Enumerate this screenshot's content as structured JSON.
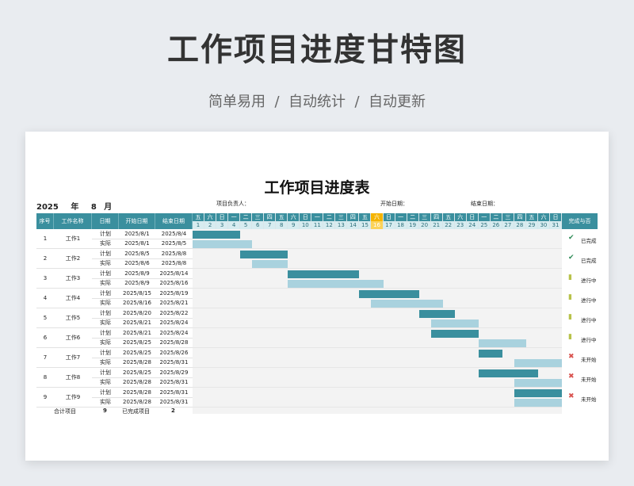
{
  "hero": {
    "title": "工作项目进度甘特图",
    "subtitle": "简单易用  /  自动统计  /  自动更新"
  },
  "sheet": {
    "title": "工作项目进度表",
    "year": "2025",
    "year_unit": "年",
    "month": "8",
    "month_unit": "月",
    "manager_label": "项目负责人：",
    "start_label": "开始日期：",
    "end_label": "结束日期："
  },
  "header": {
    "seq": "序号",
    "name": "工作名称",
    "type": "日期",
    "start": "开始日期",
    "end": "结束日期",
    "status": "完成与否"
  },
  "days": {
    "weekdays": [
      "五",
      "六",
      "日",
      "一",
      "二",
      "三",
      "四",
      "五",
      "六",
      "日",
      "一",
      "二",
      "三",
      "四",
      "五",
      "六",
      "日",
      "一",
      "二",
      "三",
      "四",
      "五",
      "六",
      "日",
      "一",
      "二",
      "三",
      "四",
      "五",
      "六",
      "日"
    ],
    "numbers": [
      "1",
      "2",
      "3",
      "4",
      "5",
      "6",
      "7",
      "8",
      "9",
      "10",
      "11",
      "12",
      "13",
      "14",
      "15",
      "16",
      "17",
      "18",
      "19",
      "20",
      "21",
      "22",
      "23",
      "24",
      "25",
      "26",
      "27",
      "28",
      "29",
      "30",
      "31"
    ],
    "highlight_day": 16
  },
  "labels": {
    "plan": "计划",
    "actual": "实际"
  },
  "tasks": [
    {
      "seq": "1",
      "name": "工作1",
      "plan_start": "2025/8/1",
      "plan_end": "2025/8/4",
      "actual_start": "2025/8/1",
      "actual_end": "2025/8/5",
      "status": "已完成",
      "status_icon": "check-icon"
    },
    {
      "seq": "2",
      "name": "工作2",
      "plan_start": "2025/8/5",
      "plan_end": "2025/8/8",
      "actual_start": "2025/8/6",
      "actual_end": "2025/8/8",
      "status": "已完成",
      "status_icon": "check-icon"
    },
    {
      "seq": "3",
      "name": "工作3",
      "plan_start": "2025/8/9",
      "plan_end": "2025/8/14",
      "actual_start": "2025/8/9",
      "actual_end": "2025/8/16",
      "status": "进行中",
      "status_icon": "progress-icon"
    },
    {
      "seq": "4",
      "name": "工作4",
      "plan_start": "2025/8/15",
      "plan_end": "2025/8/19",
      "actual_start": "2025/8/16",
      "actual_end": "2025/8/21",
      "status": "进行中",
      "status_icon": "progress-icon"
    },
    {
      "seq": "5",
      "name": "工作5",
      "plan_start": "2025/8/20",
      "plan_end": "2025/8/22",
      "actual_start": "2025/8/21",
      "actual_end": "2025/8/24",
      "status": "进行中",
      "status_icon": "progress-icon"
    },
    {
      "seq": "6",
      "name": "工作6",
      "plan_start": "2025/8/21",
      "plan_end": "2025/8/24",
      "actual_start": "2025/8/25",
      "actual_end": "2025/8/28",
      "status": "进行中",
      "status_icon": "progress-icon"
    },
    {
      "seq": "7",
      "name": "工作7",
      "plan_start": "2025/8/25",
      "plan_end": "2025/8/26",
      "actual_start": "2025/8/28",
      "actual_end": "2025/8/31",
      "status": "未开始",
      "status_icon": "cross-icon"
    },
    {
      "seq": "8",
      "name": "工作8",
      "plan_start": "2025/8/25",
      "plan_end": "2025/8/29",
      "actual_start": "2025/8/28",
      "actual_end": "2025/8/31",
      "status": "未开始",
      "status_icon": "cross-icon"
    },
    {
      "seq": "9",
      "name": "工作9",
      "plan_start": "2025/8/28",
      "plan_end": "2025/8/31",
      "actual_start": "2025/8/28",
      "actual_end": "2025/8/31",
      "status": "未开始",
      "status_icon": "cross-icon"
    }
  ],
  "summary": {
    "total_label": "合计项目",
    "total_value": "9",
    "done_label": "已完成项目",
    "done_value": "2"
  },
  "colors": {
    "header": "#3a8f9e",
    "plan_bar": "#3a8f9e",
    "actual_bar": "#a9d2de",
    "today": "#f5b400",
    "check": "#2e8b57",
    "progress": "#b8c24a",
    "cross": "#d9534f"
  }
}
